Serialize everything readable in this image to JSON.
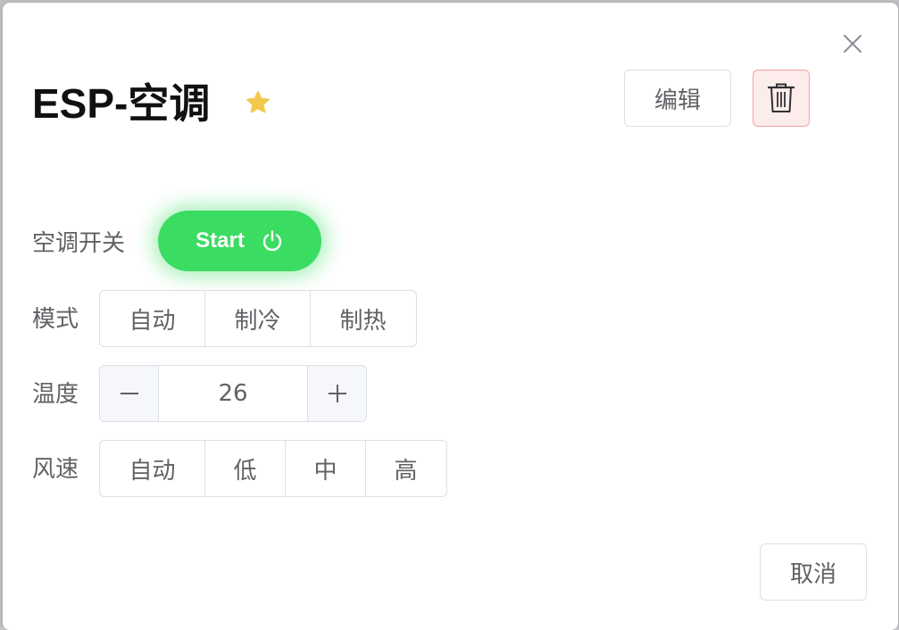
{
  "dialog": {
    "title": "ESP-空调",
    "edit_label": "编辑",
    "cancel_label": "取消",
    "icons": {
      "close": "close-icon",
      "favorite": "star-icon",
      "delete": "trash-icon",
      "power": "power-icon",
      "minus": "minus-icon",
      "plus": "plus-icon"
    },
    "colors": {
      "accent_green": "#3bdc62",
      "star": "#f2c94c",
      "delete_border": "#f5a3a3",
      "delete_bg": "#fdecec"
    }
  },
  "power": {
    "label": "空调开关",
    "button_label": "Start"
  },
  "mode": {
    "label": "模式",
    "options": [
      "自动",
      "制冷",
      "制热"
    ]
  },
  "temperature": {
    "label": "温度",
    "value": "26"
  },
  "fan_speed": {
    "label": "风速",
    "options": [
      "自动",
      "低",
      "中",
      "高"
    ]
  }
}
